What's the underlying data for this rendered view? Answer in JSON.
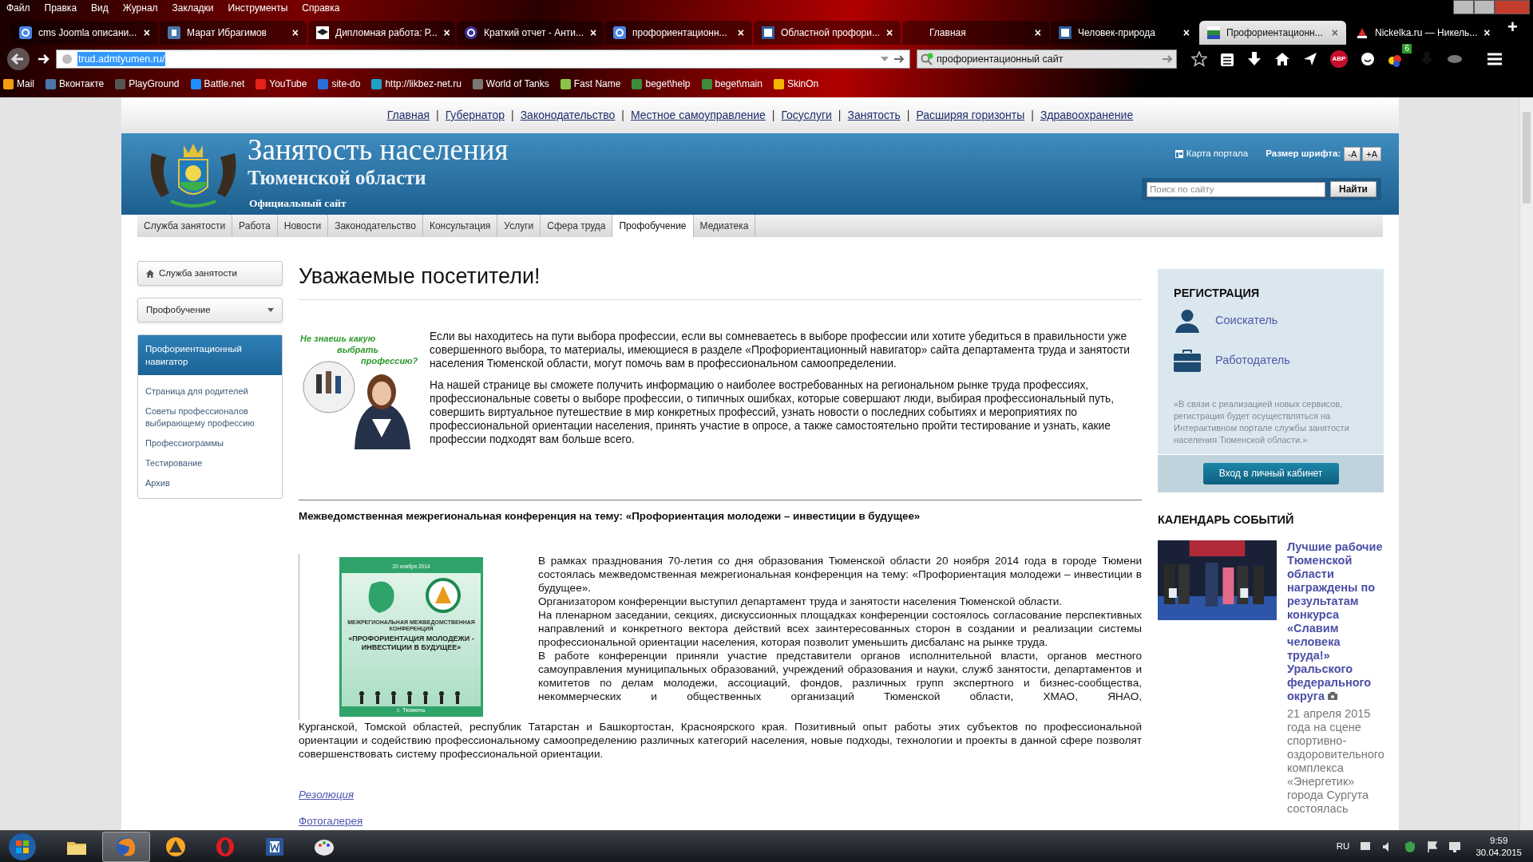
{
  "browser": {
    "menu": [
      "Файл",
      "Правка",
      "Вид",
      "Журнал",
      "Закладки",
      "Инструменты",
      "Справка"
    ],
    "tabs": [
      {
        "label": "cms Joomla описани...",
        "kind": "g",
        "close": "×",
        "selected": false
      },
      {
        "label": "Марат Ибрагимов",
        "kind": "vk",
        "close": "×",
        "selected": false
      },
      {
        "label": "Дипломная работа: Р...",
        "kind": "cap",
        "close": "×",
        "selected": false
      },
      {
        "label": "Краткий отчет - Анти...",
        "kind": "c",
        "close": "×",
        "selected": false
      },
      {
        "label": "профориентационн...",
        "kind": "g",
        "close": "×",
        "selected": false
      },
      {
        "label": "Областной профори...",
        "kind": "doc",
        "close": "×",
        "selected": false
      },
      {
        "label": "Главная",
        "kind": "blank",
        "close": "×",
        "selected": false
      },
      {
        "label": "Человек-природа",
        "kind": "doc",
        "close": "×",
        "selected": false
      },
      {
        "label": "Профориентационн...",
        "kind": "flag",
        "close": "×",
        "selected": true
      },
      {
        "label": "Nickelka.ru — Никель...",
        "kind": "hat",
        "close": "×",
        "selected": false
      }
    ],
    "new_tab": "+",
    "address": "trud.admtyumen.ru/",
    "search": "профориентационный сайт",
    "adblock": "ABP",
    "addon_count": "6",
    "bookmarks": [
      {
        "label": "Mail",
        "color": "#f39c12"
      },
      {
        "label": "Вконтакте",
        "color": "#4a76a8"
      },
      {
        "label": "PlayGround",
        "color": "#555555"
      },
      {
        "label": "Battle.net",
        "color": "#1e90ff"
      },
      {
        "label": "YouTube",
        "color": "#e62117"
      },
      {
        "label": "site-do",
        "color": "#2a6fd6"
      },
      {
        "label": "http://likbez-net.ru",
        "color": "#1fa0c8"
      },
      {
        "label": "World of Tanks",
        "color": "#777777"
      },
      {
        "label": "Fast Name",
        "color": "#8bc34a"
      },
      {
        "label": "beget\\help",
        "color": "#3c8c3c"
      },
      {
        "label": "beget\\main",
        "color": "#3c8c3c"
      },
      {
        "label": "SkinOn",
        "color": "#f5b400"
      }
    ]
  },
  "portal_links": [
    {
      "label": "Главная"
    },
    {
      "separator": "|",
      "label": "Губернатор"
    },
    {
      "separator": "|",
      "label": "Законодательство"
    },
    {
      "separator": "|",
      "label": "Местное самоуправление"
    },
    {
      "separator": "|",
      "label": "Госуслуги"
    },
    {
      "separator": "|",
      "label": "Занятость"
    },
    {
      "separator": "|",
      "label": "Расширяя горизонты"
    },
    {
      "separator": "|",
      "label": "Здравоохранение"
    }
  ],
  "header": {
    "title": "Занятость населения",
    "subtitle": "Тюменской области",
    "tagline": "Официальный сайт",
    "sitemap": "Карта портала",
    "font_size_label": "Размер шрифта:",
    "font_buttons": [
      "-A",
      "+A"
    ],
    "search_placeholder": "Поиск по сайту",
    "search_button": "Найти"
  },
  "nav": [
    {
      "label": "Служба занятости",
      "selected": false
    },
    {
      "label": "Работа",
      "selected": false
    },
    {
      "label": "Новости",
      "selected": false
    },
    {
      "label": "Законодательство",
      "selected": false
    },
    {
      "label": "Консультация",
      "selected": false
    },
    {
      "label": "Услуги",
      "selected": false
    },
    {
      "label": "Сфера труда",
      "selected": false
    },
    {
      "label": "Профобучение",
      "selected": true
    },
    {
      "label": "Медиатека",
      "selected": false
    }
  ],
  "sidebar": {
    "home": "Служба занятости",
    "section": "Профобучение",
    "items": [
      {
        "label": "Профориентационный навигатор",
        "selected": true
      },
      {
        "label": "Страница для родителей",
        "selected": false
      },
      {
        "label": "Советы профессионалов выбирающему профессию",
        "selected": false
      },
      {
        "label": "Профессиограммы",
        "selected": false
      },
      {
        "label": "Тестирование",
        "selected": false
      },
      {
        "label": "Архив",
        "selected": false
      }
    ]
  },
  "main": {
    "heading": "Уважаемые посетители!",
    "promo_caption": [
      "Не знаешь какую",
      "выбрать",
      "профессию?"
    ],
    "intro": [
      "Если вы находитесь на пути выбора профессии, если вы сомневаетесь в выборе профессии или хотите убедиться в правильности уже совершенного выбора, то материалы, имеющиеся в разделе «Профориентационный навигатор» сайта департамента труда и занятости населения Тюменской области, могут помочь вам в профессиональном самоопределении.",
      "На нашей странице вы сможете получить информацию о наиболее востребованных на региональном рынке труда профессиях, профессиональные советы о выборе профессии, о типичных ошибках, которые совершают люди, выбирая профессиональный путь, совершить виртуальное путешествие в мир конкретных профессий, узнать новости о последних событиях и мероприятиях по профессиональной ориентации населения, принять участие в опросе, а также самостоятельно пройти тестирование и узнать, какие профессии подходят вам больше всего."
    ],
    "conference_title": "Межведомственная межрегиональная конференция на тему: «Профориентация молодежи – инвестиции в будущее»",
    "poster": {
      "date": "20 ноября 2014",
      "kicker": "МЕЖРЕГИОНАЛЬНАЯ МЕЖВЕДОМСТВЕННАЯ КОНФЕРЕНЦИЯ",
      "title": "«ПРОФОРИЕНТАЦИЯ МОЛОДЕЖИ - ИНВЕСТИЦИИ В БУДУЩЕЕ»",
      "city": "г. Тюмень"
    },
    "conference_text_beside": [
      "В рамках празднования 70-летия со дня образования Тюменской области 20 ноября 2014 года в городе Тюмени состоялась межведомственная межрегиональная конференция на тему: «Профориентация молодежи – инвестиции в будущее».",
      "Организатором конференции выступил департамент труда и занятости населения Тюменской области.",
      "На пленарном заседании, секциях, дискуссионных площадках конференции состоялось согласование перспективных направлений и конкретного вектора действий всех заинтересованных сторон в создании и реализации системы профессиональной ориентации населения, которая позволит уменьшить дисбаланс на рынке труда.",
      "В работе конференции приняли участие представители органов исполнительной власти, органов местного самоуправления муниципальных образований, учреждений образования и науки, служб занятости, департаментов и комитетов по делам молодежи, ассоциаций, фондов, различных групп экспертного и бизнес-сообщества, некоммерческих и общественных организаций Тюменской области, ХМАО, ЯНАО,"
    ],
    "conference_text_below": "Курганской, Томской областей, республик Татарстан и Башкортостан, Красноярского края. Позитивный опыт работы этих субъектов по профессиональной ориентации и содействию профессиональному самоопределению различных категорий населения, новые подходы, технологии и проекты в данной сфере позволят совершенствовать систему профессиональной ориентации.",
    "links": [
      {
        "label": "Резолюция",
        "kind": "italic"
      },
      {
        "label": "Фотогалерея",
        "kind": "plain"
      }
    ]
  },
  "registration": {
    "title": "РЕГИСТРАЦИЯ",
    "roles": [
      {
        "label": "Соискатель",
        "kind": "person"
      },
      {
        "label": "Работодатель",
        "kind": "employer"
      }
    ],
    "note": "«В связи с реализацией новых сервисов, регистрация будет осуществляться на Интерактивном портале службы занятости населения Тюменской области.»",
    "button": "Вход в личный кабинет"
  },
  "calendar": {
    "title": "КАЛЕНДАРЬ СОБЫТИЙ",
    "event": {
      "title": "Лучшие рабочие Тюменской области награждены по результатам конкурса «Славим человека труда!» Уральского федерального округа",
      "has_photos": true,
      "text": "21 апреля 2015 года на сцене спортивно-оздоровительного комплекса «Энергетик» города Сургута состоялась"
    }
  },
  "taskbar": {
    "apps": [
      {
        "kind": "folder",
        "selected": false
      },
      {
        "kind": "firefox",
        "selected": true
      },
      {
        "kind": "triangle",
        "selected": false
      },
      {
        "kind": "opera",
        "selected": false
      },
      {
        "kind": "word",
        "selected": false
      },
      {
        "kind": "paint",
        "selected": false
      }
    ],
    "language": "RU",
    "time": "9:59",
    "date": "30.04.2015"
  }
}
